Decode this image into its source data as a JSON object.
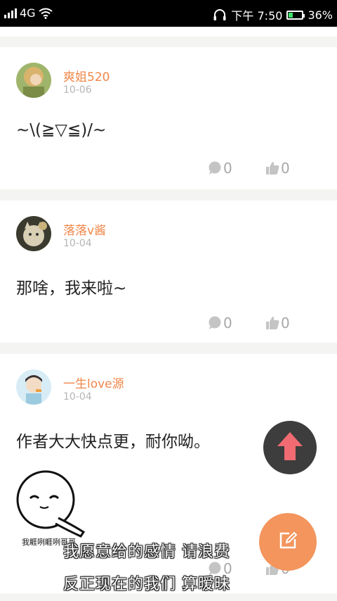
{
  "status_bar": {
    "network": "4G",
    "time": "下午 7:50",
    "battery": "36%",
    "battery_level": 0.36
  },
  "comments": [
    {
      "username": "爽姐520",
      "date": "10-06",
      "text": "~\\(≧▽≦)/~",
      "comment_count": "0",
      "like_count": "0"
    },
    {
      "username": "落落v酱",
      "date": "10-04",
      "text": "那啥，我来啦~",
      "comment_count": "0",
      "like_count": "0"
    },
    {
      "username": "一生love源",
      "date": "10-04",
      "text": "作者大大快点更，耐你呦。",
      "sticker_caption": "我睚咧睚咧哥哥",
      "comment_count": "0",
      "like_count": "0"
    }
  ],
  "subtitles": {
    "line1": "我愿意给的感情 请浪费",
    "line2": "反正现在的我们 算暧昧"
  },
  "colors": {
    "username": "#f0874a",
    "scroll_top_bg": "#3d3d3d",
    "scroll_top_arrow": "#f06b72",
    "compose_bg": "#f3955d"
  },
  "icons": {
    "scroll_top": "arrow-up-icon",
    "compose": "edit-icon",
    "comment": "speech-bubble-icon",
    "like": "thumbs-up-icon"
  }
}
